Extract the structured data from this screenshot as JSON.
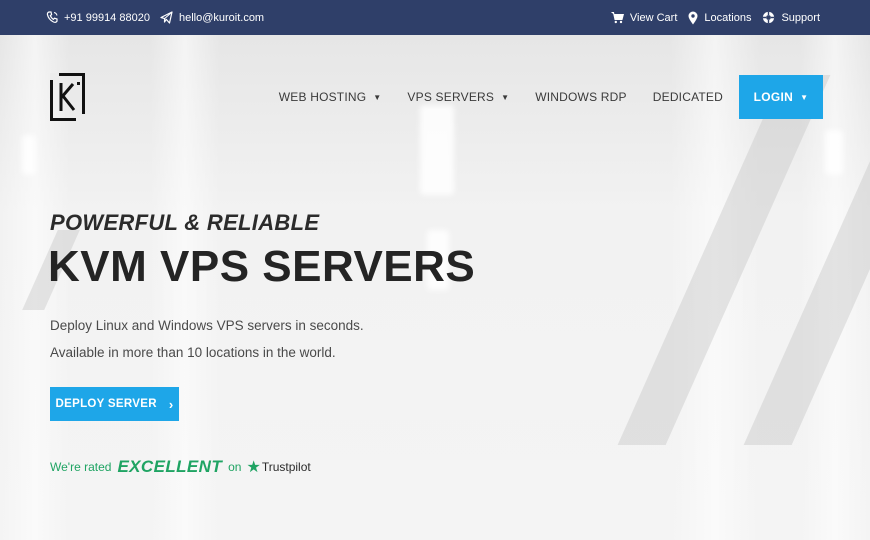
{
  "topbar": {
    "phone": "+91 99914 88020",
    "email": "hello@kuroit.com",
    "view_cart": "View Cart",
    "locations": "Locations",
    "support": "Support"
  },
  "nav": {
    "items": [
      {
        "label": "WEB HOSTING",
        "has_dropdown": true
      },
      {
        "label": "VPS SERVERS",
        "has_dropdown": true
      },
      {
        "label": "WINDOWS RDP",
        "has_dropdown": false
      },
      {
        "label": "DEDICATED",
        "has_dropdown": false
      }
    ],
    "login_label": "LOGIN"
  },
  "hero": {
    "subtitle": "POWERFUL & RELIABLE",
    "title": "KVM VPS SERVERS",
    "desc_line1": "Deploy Linux and Windows VPS servers in seconds.",
    "desc_line2": "Available in more than 10 locations in the world.",
    "cta_label": "DEPLOY SERVER"
  },
  "rating": {
    "prefix": "We're rated",
    "grade": "EXCELLENT",
    "on": "on",
    "platform": "Trustpilot"
  },
  "icons": {
    "phone": "phone-icon",
    "email": "paper-plane-icon",
    "cart": "cart-icon",
    "location": "map-pin-icon",
    "support": "lifebuoy-icon",
    "dropdown": "chevron-down-icon",
    "cta_arrow": "chevron-right-icon",
    "trustpilot": "star-icon"
  },
  "colors": {
    "topbar_bg": "#2f3f69",
    "accent_blue": "#1ea6e8",
    "trust_green": "#1fa463",
    "heading": "#242424"
  }
}
